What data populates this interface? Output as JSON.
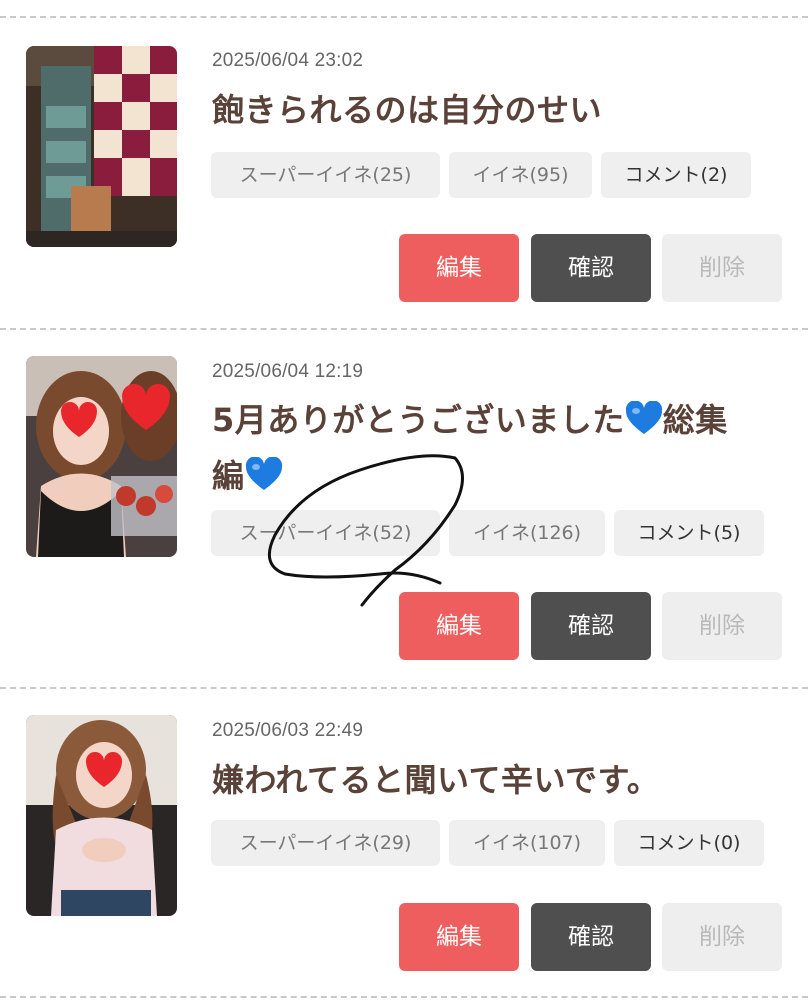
{
  "posts": [
    {
      "date": "2025/06/04 23:02",
      "title": "飽きられるのは自分のせい",
      "super_iine": "スーパーイイネ(25)",
      "iine": "イイネ(95)",
      "comment": "コメント(2)",
      "edit_label": "編集",
      "confirm_label": "確認",
      "delete_label": "削除"
    },
    {
      "date": "2025/06/04 12:19",
      "title_line1": "5月ありがとうございました",
      "title_line1_tail": "総集",
      "title_line2": "編",
      "heart_emoji": "💙",
      "super_iine": "スーパーイイネ(52)",
      "iine": "イイネ(126)",
      "comment": "コメント(5)",
      "edit_label": "編集",
      "confirm_label": "確認",
      "delete_label": "削除"
    },
    {
      "date": "2025/06/03 22:49",
      "title": "嫌われてると聞いて辛いです。",
      "super_iine": "スーパーイイネ(29)",
      "iine": "イイネ(107)",
      "comment": "コメント(0)",
      "edit_label": "編集",
      "confirm_label": "確認",
      "delete_label": "削除"
    }
  ],
  "colors": {
    "edit_button": "#ef5e5e",
    "confirm_button": "#4f4f4f",
    "delete_button": "#eeeeee",
    "title_text": "#5a4238",
    "heart_blue": "#1e7be0"
  },
  "icons": [
    "heart-blue-icon",
    "handwritten-circle-annotation"
  ]
}
